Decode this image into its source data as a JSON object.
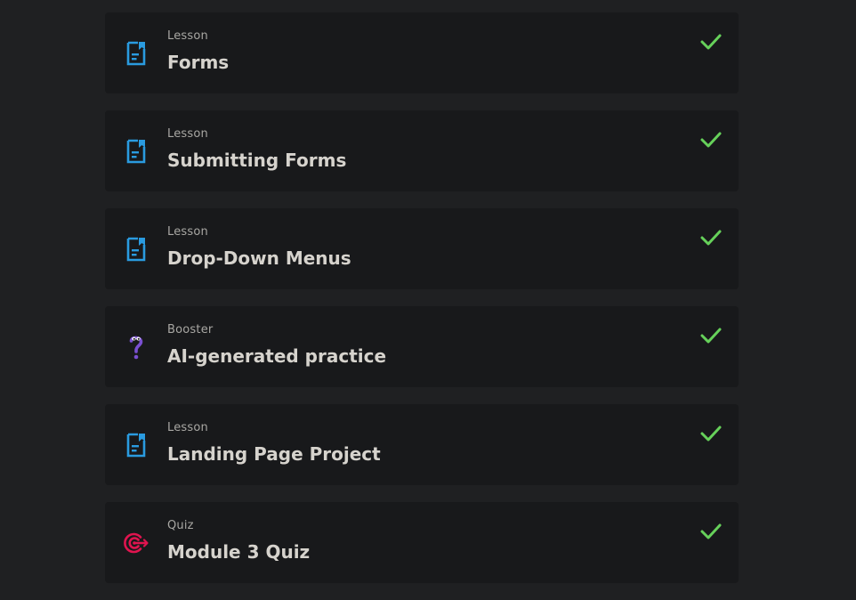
{
  "items": [
    {
      "type": "Lesson",
      "title": "Forms",
      "icon": "lesson-document-icon",
      "completed": true
    },
    {
      "type": "Lesson",
      "title": "Submitting Forms",
      "icon": "lesson-document-icon",
      "completed": true
    },
    {
      "type": "Lesson",
      "title": "Drop-Down Menus",
      "icon": "lesson-document-icon",
      "completed": true
    },
    {
      "type": "Booster",
      "title": "AI-generated practice",
      "icon": "booster-question-icon",
      "completed": true
    },
    {
      "type": "Lesson",
      "title": "Landing Page Project",
      "icon": "lesson-document-icon",
      "completed": true
    },
    {
      "type": "Quiz",
      "title": "Module 3 Quiz",
      "icon": "quiz-target-icon",
      "completed": true
    }
  ],
  "colors": {
    "background": "#1f2022",
    "card": "#18191b",
    "lesson_icon": "#2a9be0",
    "booster_icon": "#7a4fd1",
    "quiz_icon": "#e0144f",
    "check": "#66d15a"
  }
}
